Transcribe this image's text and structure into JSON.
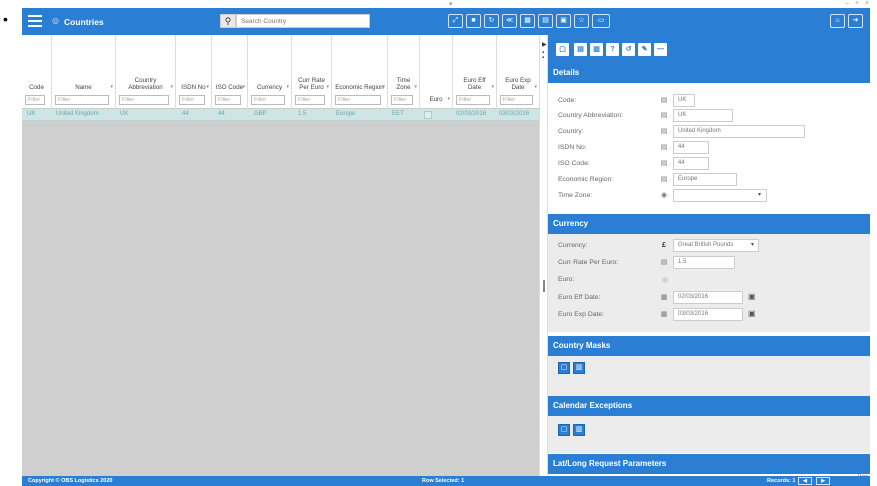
{
  "header": {
    "title": "Countries",
    "search_placeholder": "Search Country",
    "toolbar_icons": [
      "expand-icon",
      "copy-icon",
      "refresh-icon",
      "share-icon",
      "grid-icon",
      "document-icon",
      "print-icon",
      "star-icon",
      "panel-icon"
    ],
    "right_icons": [
      "home-icon",
      "exit-icon"
    ]
  },
  "grid": {
    "columns": [
      {
        "label": "Code",
        "filter": "Filter"
      },
      {
        "label": "Name",
        "filter": "Filter"
      },
      {
        "label": "Country Abbreviation",
        "filter": "Filter"
      },
      {
        "label": "ISDN No",
        "filter": "Filter"
      },
      {
        "label": "ISO Code",
        "filter": "Filter"
      },
      {
        "label": "Currency",
        "filter": "Filter"
      },
      {
        "label": "Curr Rate Per Euro",
        "filter": "Filter"
      },
      {
        "label": "Economic Region",
        "filter": "Filter"
      },
      {
        "label": "Time Zone",
        "filter": "Filter"
      },
      {
        "label": "Euro",
        "filter": ""
      },
      {
        "label": "Euro Eff Date",
        "filter": "Filter"
      },
      {
        "label": "Euro Exp Date",
        "filter": "Filter"
      }
    ],
    "rows": [
      [
        "UK",
        "United Kingdom",
        "UK",
        "44",
        "44",
        "GBP",
        "1.5",
        "Europe",
        "EET",
        "",
        "02/03/2016",
        "03/03/2016"
      ]
    ]
  },
  "panel": {
    "toolbar_icons": [
      "new-icon",
      "save-icon",
      "delete-icon",
      "help-icon",
      "undo-icon",
      "edit-icon",
      "minus-icon"
    ],
    "details": {
      "title": "Details",
      "fields": [
        {
          "label": "Code:",
          "value": "UK"
        },
        {
          "label": "Country Abbreviation:",
          "value": "UK"
        },
        {
          "label": "Country:",
          "value": "United Kingdom"
        },
        {
          "label": "ISDN No:",
          "value": "44"
        },
        {
          "label": "ISO Code:",
          "value": "44"
        },
        {
          "label": "Economic Region:",
          "value": "Europe"
        },
        {
          "label": "Time Zone:",
          "value": ""
        }
      ]
    },
    "currency": {
      "title": "Currency",
      "currency_label": "Currency:",
      "currency_value": "Great British Pounds",
      "rate_label": "Curr Rate Per Euro:",
      "rate_value": "1.5",
      "euro_label": "Euro:",
      "eff_label": "Euro Eff Date:",
      "eff_value": "02/03/2016",
      "exp_label": "Euro Exp Date:",
      "exp_value": "03/03/2016"
    },
    "masks_title": "Country Masks",
    "exceptions_title": "Calendar Exceptions",
    "latlong_title": "Lat/Long Request Parameters"
  },
  "footer": {
    "copyright": "Copyright © OBS Logistics 2020",
    "row_selected": "Row Selected: 1",
    "records": "Records: 1"
  },
  "version_label": "Vers",
  "colors": {
    "accent": "#2a7fd4",
    "row_selected": "#cfe4e4",
    "grid_empty": "#cfcfcf"
  }
}
